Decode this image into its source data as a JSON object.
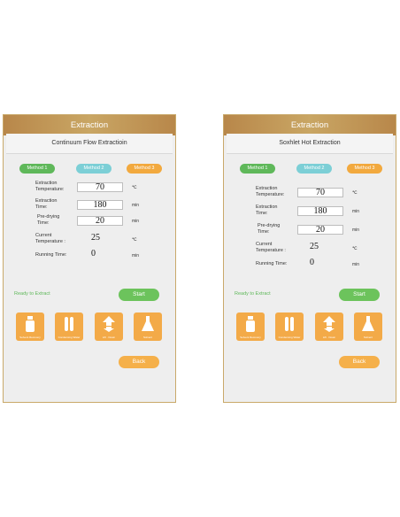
{
  "screens": [
    {
      "header_title": "Extraction",
      "subtitle": "Continuum Flow Extractioin",
      "methods": [
        "Method 1",
        "Method 2",
        "Method 3"
      ],
      "fields": {
        "extraction_temperature": {
          "label_line1": "Extraction",
          "label_line2": "Temperature:",
          "value": "70",
          "unit": "℃"
        },
        "extraction_time": {
          "label_line1": "Extraction",
          "label_line2": "Time:",
          "value": "180",
          "unit": "min"
        },
        "predrying_time": {
          "label_line1": "Pre-drying",
          "label_line2": "Time:",
          "value": "20",
          "unit": "min"
        },
        "current_temperature": {
          "label_line1": "Current",
          "label_line2": "Temperature :",
          "value": "25",
          "unit": "℃"
        },
        "running_time": {
          "label": "Running Time:",
          "value": "0",
          "unit": "min"
        }
      },
      "status": "Ready to Extract",
      "start_label": "Start",
      "tiles": [
        "Solvent Recovery",
        "Condensing Water",
        "Lift · Down",
        "Solvent"
      ],
      "back_label": "Back"
    },
    {
      "header_title": "Extraction",
      "subtitle": "Soxhlet Hot Extraction",
      "methods": [
        "Method 1",
        "Method 2",
        "Method 3"
      ],
      "fields": {
        "extraction_temperature": {
          "label_line1": "Extraction",
          "label_line2": "Temperature:",
          "value": "70",
          "unit": "℃"
        },
        "extraction_time": {
          "label_line1": "Extraction",
          "label_line2": "Time:",
          "value": "180",
          "unit": "min"
        },
        "predrying_time": {
          "label_line1": "Pre-drying",
          "label_line2": "Time:",
          "value": "20",
          "unit": "min"
        },
        "current_temperature": {
          "label_line1": "Current",
          "label_line2": "Temperature :",
          "value": "25",
          "unit": "℃"
        },
        "running_time": {
          "label": "Running Time:",
          "value": "0",
          "unit": "min"
        }
      },
      "status": "Ready to Extract",
      "start_label": "Start",
      "tiles": [
        "Solvent Recovery",
        "Condensing Water",
        "Lift · Down",
        "Solvent"
      ],
      "back_label": "Back"
    }
  ],
  "colors": {
    "header": "#c3a05f",
    "green": "#5fb85a",
    "teal": "#7ccfd6",
    "orange": "#f2a93e"
  }
}
